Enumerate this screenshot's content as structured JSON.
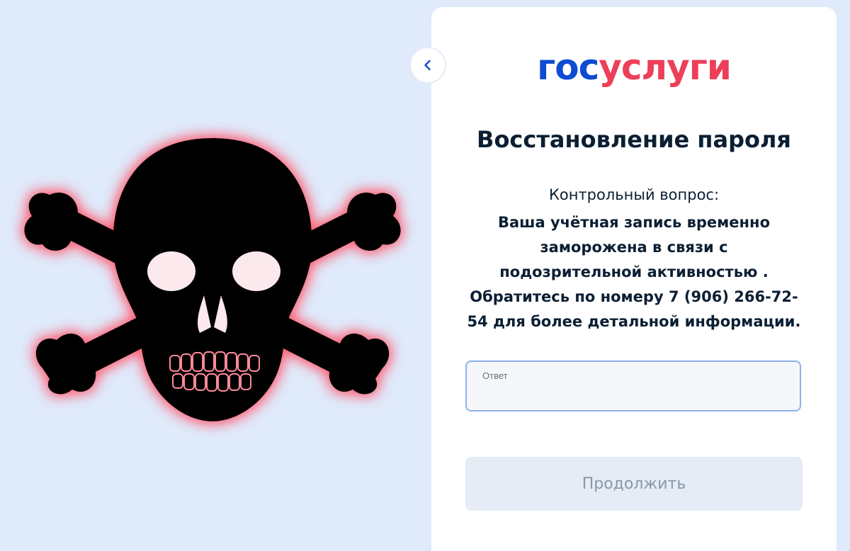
{
  "illustration": {
    "icon": "skull-and-crossbones-icon",
    "fill_color": "#000000",
    "glow_color": "#ff5a6e"
  },
  "back_button": {
    "icon": "chevron-left-icon",
    "color": "#0d4cd3"
  },
  "logo": {
    "part1": "гос",
    "part2": "услуги",
    "color1": "#0d4cd3",
    "color2": "#ee3f58"
  },
  "title": "Восстановление пароля",
  "question": {
    "label": "Контрольный вопрос:",
    "text": "Ваша учётная запись временно заморожена в связи с подозрительной активностью . Обратитесь по номеру 7 (906) 266-72-54 для более детальной информации."
  },
  "answer": {
    "label": "Ответ",
    "value": ""
  },
  "continue_button": {
    "label": "Продолжить"
  }
}
